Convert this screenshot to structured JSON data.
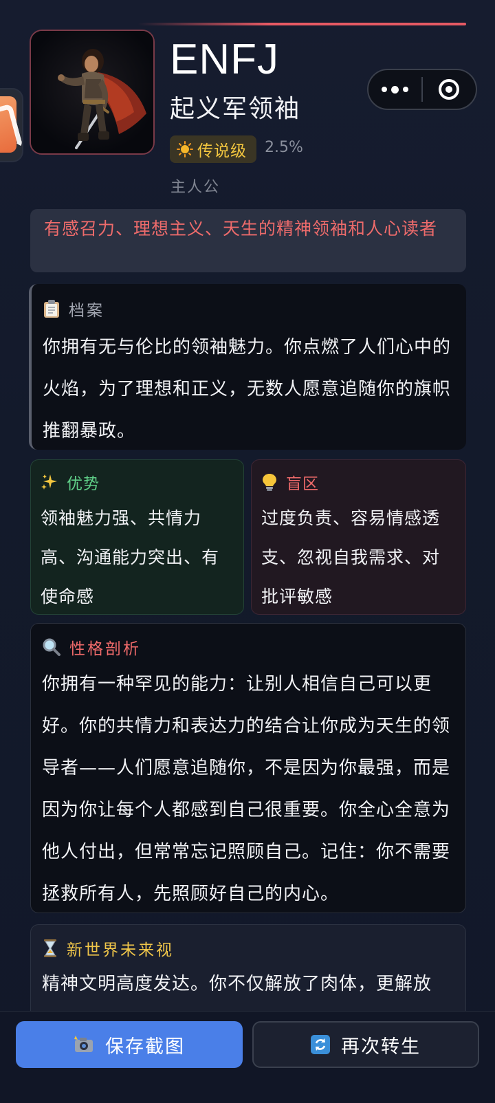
{
  "header": {
    "type_code": "ENFJ",
    "role_title": "起义军领袖",
    "rarity_label": "传说级",
    "rarity_percent": "2.5%",
    "alias": "主人公"
  },
  "tagline": "有感召力、理想主义、天生的精神领袖和人心读者",
  "profile": {
    "heading": "档案",
    "body": "你拥有无与伦比的领袖魅力。你点燃了人们心中的火焰，为了理想和正义，无数人愿意追随你的旗帜推翻暴政。",
    "icon": "clipboard-icon"
  },
  "strengths": {
    "heading": "优势",
    "body": "领袖魅力强、共情力高、沟通能力突出、有使命感",
    "icon": "sparkles-icon",
    "color": "#5fcf88"
  },
  "blind_spots": {
    "heading": "盲区",
    "body": "过度负责、容易情感透支、忽视自我需求、对批评敏感",
    "icon": "lightbulb-icon",
    "color": "#ef6a6a"
  },
  "analysis": {
    "heading": "性格剖析",
    "body": "你拥有一种罕见的能力：让别人相信自己可以更好。你的共情力和表达力的结合让你成为天生的领导者——人们愿意追随你，不是因为你最强，而是因为你让每个人都感到自己很重要。你全心全意为他人付出，但常常忘记照顾自己。记住：你不需要拯救所有人，先照顾好自己的内心。",
    "icon": "magnifier-icon",
    "color": "#ef6a6a"
  },
  "future": {
    "heading": "新世界未来视",
    "body": "精神文明高度发达。你不仅解放了肉体，更解放",
    "icon": "hourglass-icon",
    "color": "#f0c64a"
  },
  "actions": {
    "save_label": "保存截图",
    "reborn_label": "再次转生"
  },
  "colors": {
    "accent_red": "#e85a64",
    "gold": "#f4c73f",
    "primary_blue": "#4a7fe8"
  }
}
